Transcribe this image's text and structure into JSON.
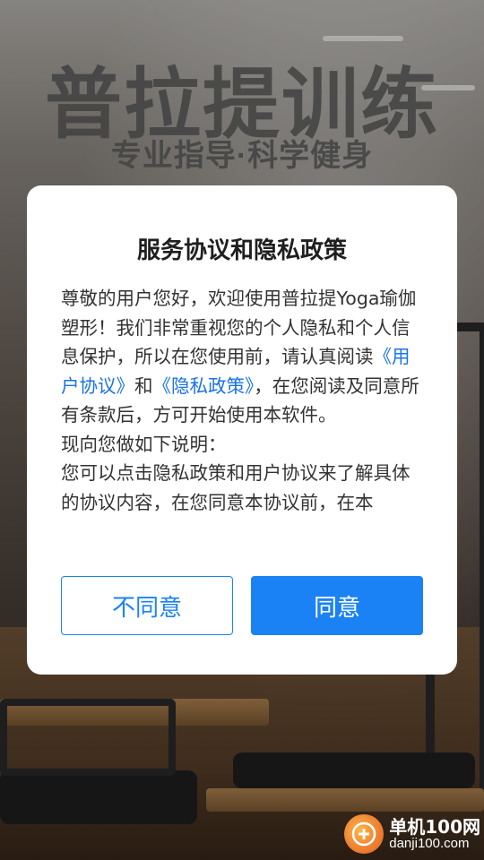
{
  "hero": {
    "title": "普拉提训练",
    "subtitle": "专业指导·科学健身"
  },
  "dialog": {
    "title": "服务协议和隐私政策",
    "body": {
      "part1": "尊敬的用户您好，欢迎使用普拉提Yoga瑜伽塑形！我们非常重视您的个人隐私和个人信息保护，所以在您使用前，请认真阅读",
      "link_user_agreement": "《用户协议》",
      "and": "和",
      "link_privacy_policy": "《隐私政策》",
      "part2": "，在您阅读及同意所有条款后，方可开始使用本软件。",
      "para2": "现向您做如下说明：",
      "para3": "您可以点击隐私政策和用户协议来了解具体的协议内容，在您同意本协议前，在本"
    },
    "disagree_label": "不同意",
    "agree_label": "同意"
  },
  "watermark": {
    "name": "单机100网",
    "url": "danji100.com"
  },
  "colors": {
    "accent": "#1a82f5",
    "link": "#1a73e8"
  }
}
